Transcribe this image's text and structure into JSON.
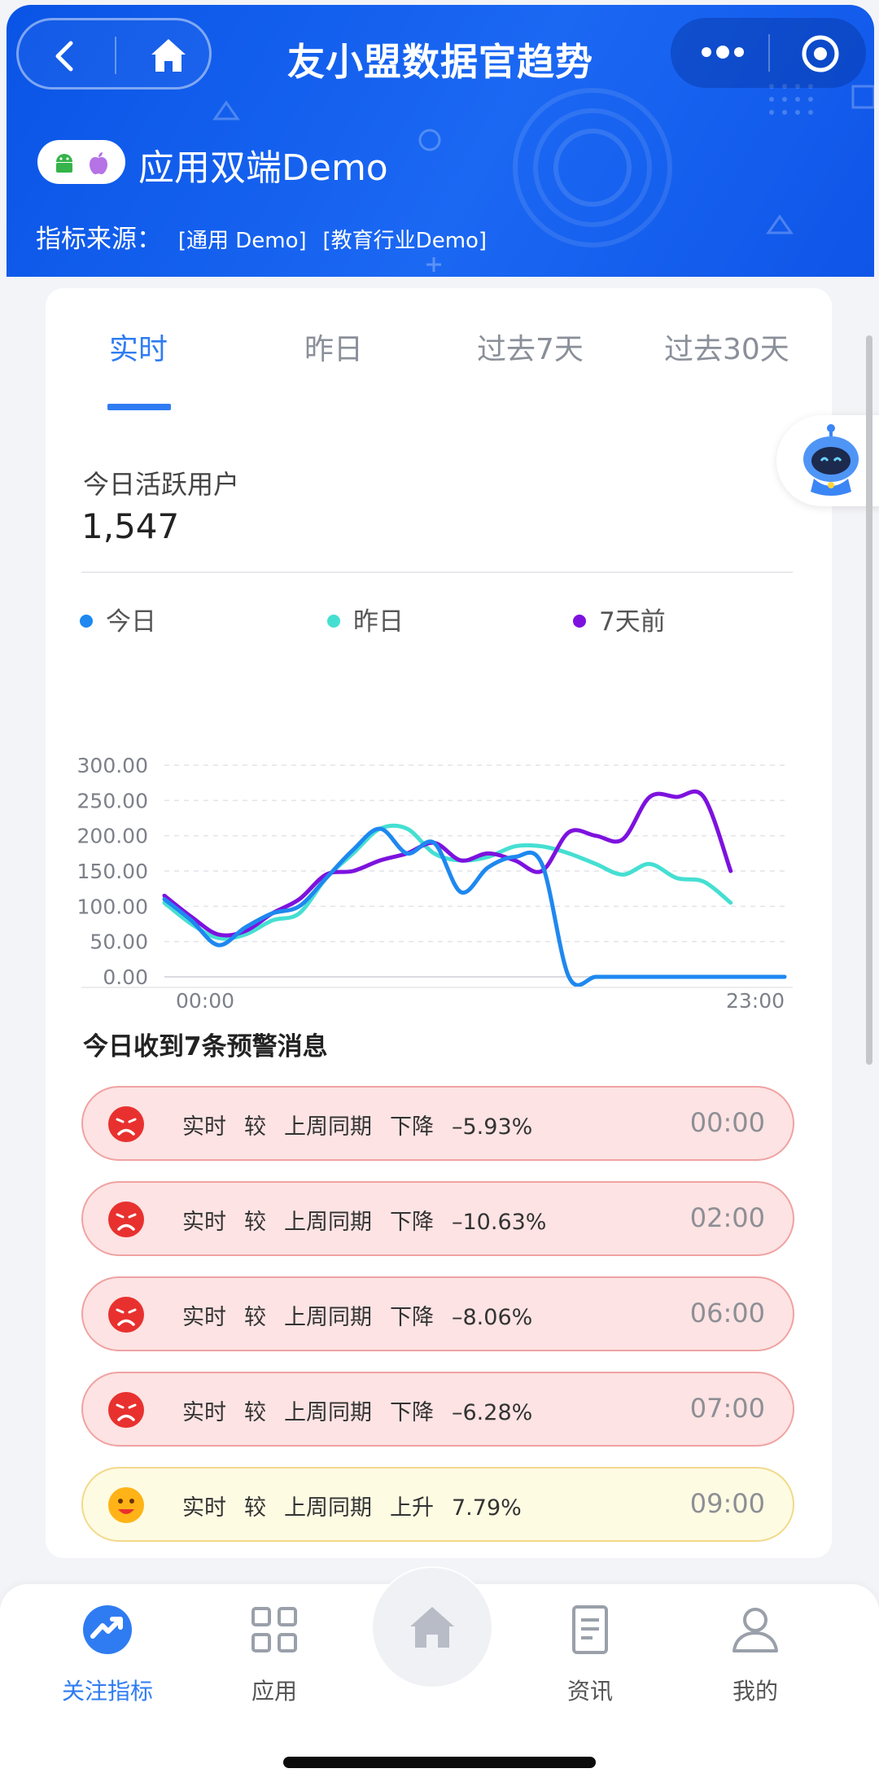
{
  "header": {
    "title": "友小盟数据官趋势",
    "app_name": "应用双端Demo",
    "source_label": "指标来源：",
    "source_tags": [
      "[通用 Demo]",
      "[教育行业Demo]"
    ]
  },
  "tabs": [
    {
      "label": "实时",
      "active": true
    },
    {
      "label": "昨日",
      "active": false
    },
    {
      "label": "过去7天",
      "active": false
    },
    {
      "label": "过去30天",
      "active": false
    }
  ],
  "metric": {
    "label": "今日活跃用户",
    "value": "1,547"
  },
  "legend": [
    {
      "name": "今日",
      "color": "#1e88f0"
    },
    {
      "name": "昨日",
      "color": "#45dfd2"
    },
    {
      "name": "7天前",
      "color": "#7d12de"
    }
  ],
  "chart_data": {
    "type": "line",
    "x_start_label": "00:00",
    "x_end_label": "23:00",
    "x": [
      0,
      1,
      2,
      3,
      4,
      5,
      6,
      7,
      8,
      9,
      10,
      11,
      12,
      13,
      14,
      15,
      16,
      17,
      18,
      19,
      20,
      21,
      22,
      23
    ],
    "ylim": [
      0,
      300
    ],
    "yticks": [
      "0.00",
      "50.00",
      "100.00",
      "150.00",
      "200.00",
      "250.00",
      "300.00"
    ],
    "grid": true,
    "series": [
      {
        "name": "今日",
        "color": "#1e88f0",
        "values": [
          110,
          80,
          45,
          70,
          90,
          100,
          140,
          180,
          210,
          175,
          190,
          120,
          155,
          170,
          160,
          0,
          0,
          0,
          0,
          0,
          0,
          0,
          0,
          0
        ]
      },
      {
        "name": "昨日",
        "color": "#45dfd2",
        "values": [
          105,
          75,
          55,
          60,
          80,
          90,
          140,
          175,
          210,
          210,
          175,
          165,
          170,
          185,
          185,
          175,
          160,
          145,
          160,
          140,
          135,
          105,
          null,
          null
        ]
      },
      {
        "name": "7天前",
        "color": "#7d12de",
        "values": [
          115,
          85,
          60,
          65,
          90,
          110,
          145,
          150,
          165,
          175,
          190,
          165,
          175,
          165,
          150,
          205,
          200,
          195,
          255,
          255,
          255,
          150,
          null,
          null
        ]
      }
    ]
  },
  "alerts_title": "今日收到7条预警消息",
  "alerts": [
    {
      "type": "bad",
      "parts": [
        "实时",
        "较",
        "上周同期",
        "下降",
        "–5.93%"
      ],
      "time": "00:00"
    },
    {
      "type": "bad",
      "parts": [
        "实时",
        "较",
        "上周同期",
        "下降",
        "–10.63%"
      ],
      "time": "02:00"
    },
    {
      "type": "bad",
      "parts": [
        "实时",
        "较",
        "上周同期",
        "下降",
        "–8.06%"
      ],
      "time": "06:00"
    },
    {
      "type": "bad",
      "parts": [
        "实时",
        "较",
        "上周同期",
        "下降",
        "–6.28%"
      ],
      "time": "07:00"
    },
    {
      "type": "good",
      "parts": [
        "实时",
        "较",
        "上周同期",
        "上升",
        "7.79%"
      ],
      "time": "09:00"
    }
  ],
  "nav": [
    {
      "label": "关注指标",
      "icon": "trend-icon",
      "active": true
    },
    {
      "label": "应用",
      "icon": "apps-grid-icon",
      "active": false
    },
    {
      "label": "资讯",
      "icon": "document-icon",
      "active": false
    },
    {
      "label": "我的",
      "icon": "user-icon",
      "active": false
    }
  ],
  "colors": {
    "accent": "#2f7cf2",
    "header_blue": "#1560ee",
    "alert_bad_bg": "#fde3e3",
    "alert_good_bg": "#fefbe3"
  }
}
